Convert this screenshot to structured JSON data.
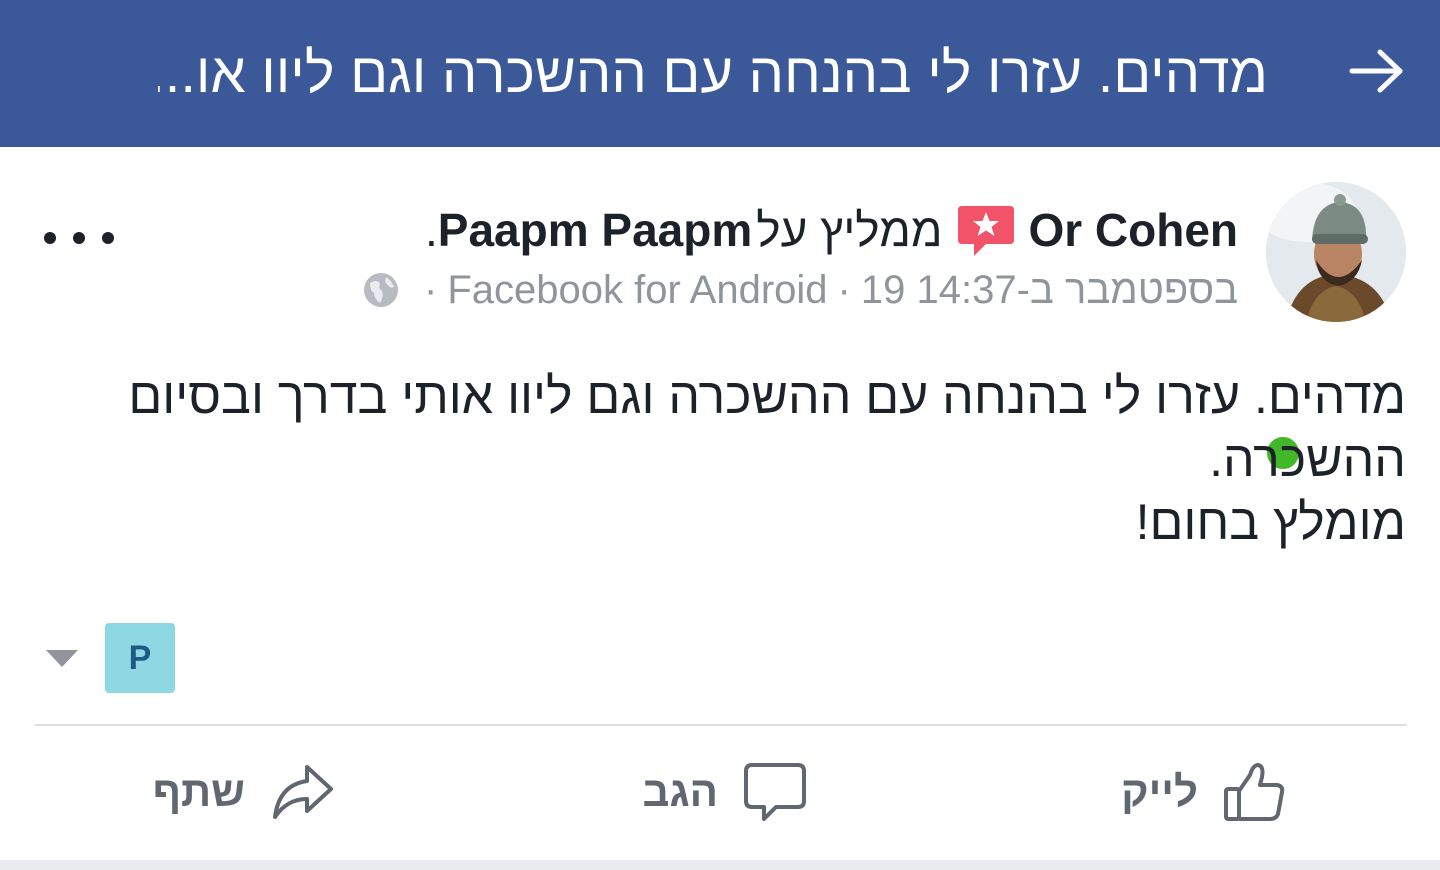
{
  "topbar": {
    "title": "מדהים. עזרו לי בהנחה עם ההשכרה וגם ליוו או...",
    "back_icon": "arrow-right-icon",
    "bg_color": "#3b5998"
  },
  "post": {
    "author": "Or Cohen",
    "recommends_text": "ממליץ על",
    "page_name": "Paapm Paapm",
    "period": ".",
    "date": "19 בספטמבר ב-14:37",
    "separator": "·",
    "app": "Facebook for Android",
    "privacy_icon": "globe-icon",
    "badge_icon": "recommendation-star-icon",
    "body_lines": [
      "מדהים. עזרו לי בהנחה עם ההשכרה וגם ליוו אותי בדרך ובסיום",
      "ההשכרה.",
      "מומלץ בחום!"
    ],
    "page_chip_letter": "P",
    "online": true
  },
  "actions": {
    "like": "לייק",
    "comment": "הגב",
    "share": "שתף"
  }
}
